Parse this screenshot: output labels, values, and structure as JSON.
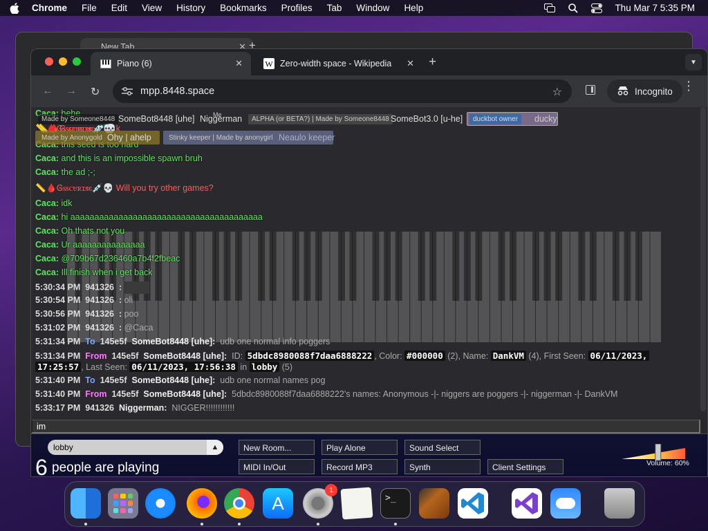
{
  "menubar": {
    "app": "Chrome",
    "items": [
      "File",
      "Edit",
      "View",
      "History",
      "Bookmarks",
      "Profiles",
      "Tab",
      "Window",
      "Help"
    ],
    "clock": "Thu Mar 7  5:35 PM"
  },
  "back_window": {
    "tab_title": "New Tab"
  },
  "browser": {
    "tabs": [
      {
        "title": "Piano (6)",
        "icon": "piano-icon"
      },
      {
        "title": "Zero-width space - Wikipedia",
        "icon": "wikipedia-icon"
      }
    ],
    "url": "mpp.8448.space",
    "incognito_label": "Incognito"
  },
  "userlist": {
    "row1": {
      "u1_tag": "Made by Someone8448",
      "u1": "SomeBot8448 [uhe]",
      "u2_tag": "Me",
      "u2": "Niggerman",
      "u3_tag": "ALPHA (or BETA?) | Made by Someone8448",
      "u3": "SomeBot3.0 [u-he]",
      "u4_tag": "duckbot owner",
      "u4": "ducky"
    },
    "row2": {
      "u5": "📏🩸Ꮆꮪꮪꮯꮜꭱꮖꮥꮛ💉💀",
      "u6_tag": "Made by Anonygold",
      "u6": "Ohy | ahelp",
      "u7_tag": "Stinky keeper | Made by anonygirl",
      "u7": "Neaulo keeper"
    }
  },
  "chat": {
    "m1": {
      "name": "Caca:",
      "text": "hehe"
    },
    "m2": {
      "name": "📏🩸Ꮆꮪꮪꮯꮜꭱꮖꮥꮛ💉💀",
      "text": "k"
    },
    "m3": {
      "name": "Caca:",
      "text": "this seed is too hard"
    },
    "m4": {
      "name": "Caca:",
      "text": "and this is an impossible spawn bruh"
    },
    "m5": {
      "name": "Caca:",
      "text": "the ad ;-;"
    },
    "m6": {
      "name": "📏🩸Ꮆꮪꮪꮯꮜꭱꮖꮥꮛ💉💀",
      "text": "Will you try other games?"
    },
    "m7": {
      "name": "Caca:",
      "text": "idk"
    },
    "m8": {
      "name": "Caca:",
      "text": "hi aaaaaaaaaaaaaaaaaaaaaaaaaaaaaaaaaaaaaaaa"
    },
    "m9": {
      "name": "Caca:",
      "text": "Oh thats not you"
    },
    "m10": {
      "name": "Caca:",
      "text": "Ur aaaaaaaaaaaaaaa"
    },
    "m11": {
      "name": "Caca:",
      "text": "@709b67d236460a7b4f2fbeac"
    },
    "m12": {
      "name": "Caca:",
      "text": "Ill finish when i get back"
    },
    "m13": {
      "time": "5:30:34 PM",
      "id": "941326",
      "colon": ":",
      "text": ""
    },
    "m14": {
      "time": "5:30:54 PM",
      "id": "941326",
      "colon": ":",
      "text": "oli"
    },
    "m15": {
      "time": "5:30:56 PM",
      "id": "941326",
      "colon": ":",
      "text": "poo"
    },
    "m16": {
      "time": "5:31:02 PM",
      "id": "941326",
      "colon": ":",
      "text": "@Caca"
    },
    "m17": {
      "time": "5:31:34 PM",
      "dir": "To",
      "id": "145e5f",
      "bot": "SomeBot8448 [uhe]:",
      "text": "udb one normal info poggers"
    },
    "m18": {
      "time": "5:31:34 PM",
      "dir": "From",
      "id": "145e5f",
      "bot": "SomeBot8448 [uhe]:",
      "id_label": "ID:",
      "id_val": "5dbdc8980088f7daa6888222",
      "color_label": ", Color:",
      "color_val": "#000000",
      "color_n": "(2), Name:",
      "name_val": "DankVM",
      "name_n": "(4), First Seen:",
      "first_seen": "06/11/2023,",
      "first_seen_time": "17:25:57",
      "last_seen_label": ", Last Seen:",
      "last_seen": "06/11/2023, 17:56:38",
      "in_label": "in",
      "room": "lobby",
      "room_n": "(5)"
    },
    "m19": {
      "time": "5:31:40 PM",
      "dir": "To",
      "id": "145e5f",
      "bot": "SomeBot8448 [uhe]:",
      "text": "udb one normal names pog"
    },
    "m20": {
      "time": "5:31:40 PM",
      "dir": "From",
      "id": "145e5f",
      "bot": "SomeBot8448 [uhe]:",
      "text": "5dbdc8980088f7daa6888222's names: Anonymous -|- niggers are poggers -|- niggerman -|- DankVM"
    },
    "m21": {
      "time": "5:33:17 PM",
      "id": "941326",
      "name": "Niggerman:",
      "text": "NIGGER!!!!!!!!!!!!"
    }
  },
  "chat_input": {
    "value": "im"
  },
  "bottombar": {
    "room": "lobby",
    "count": "6",
    "count_label": "people are playing",
    "buttons": {
      "new_room": "New Room...",
      "play_alone": "Play Alone",
      "sound_select": "Sound Select",
      "midi": "MIDI In/Out",
      "record": "Record MP3",
      "synth": "Synth",
      "client_settings": "Client Settings"
    },
    "volume_label": "Volume: 60%",
    "volume_level": 0.6
  },
  "dock": {
    "settings_badge": "1",
    "apps": [
      "finder-icon",
      "launchpad-icon",
      "safari-icon",
      "firefox-icon",
      "chrome-icon",
      "app-store-icon",
      "system-settings-icon",
      "textedit-icon",
      "terminal-icon",
      "garageband-icon",
      "vscode-icon",
      "visual-studio-icon",
      "weather-icon",
      "trash-icon"
    ]
  },
  "colors": {
    "chat_green": "#5fe65f",
    "chat_red": "#ff5a5a",
    "to_blue": "#7aa6ff",
    "from_pink": "#ff77ff",
    "traffic_red": "#ff5f57",
    "traffic_yellow": "#febc2e",
    "traffic_green": "#28c840"
  }
}
